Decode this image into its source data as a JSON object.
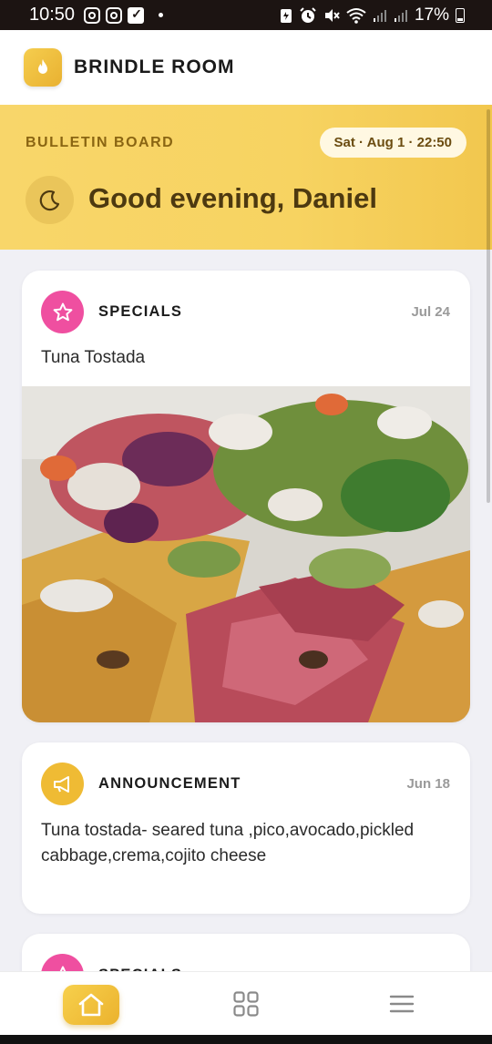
{
  "status_bar": {
    "time": "10:50",
    "battery": "17%",
    "icons": [
      "instagram-icon",
      "instagram-icon",
      "check-icon",
      "notification-dot",
      "battery-saver-icon",
      "alarm-icon",
      "mute-icon",
      "wifi-icon",
      "signal-icon",
      "signal-icon",
      "battery-icon"
    ]
  },
  "header": {
    "app_title": "BRINDLE ROOM",
    "logo_icon": "flame-icon",
    "accent": "#efbb34"
  },
  "banner": {
    "label": "BULLETIN BOARD",
    "date": "Sat · Aug 1 · 22:50",
    "greeting": "Good evening, Daniel",
    "icon": "moon-icon"
  },
  "posts": [
    {
      "category": "SPECIALS",
      "date": "Jul 24",
      "text": "Tuna Tostada",
      "icon": "star-icon",
      "color": "#ef4fa0",
      "has_image": true
    },
    {
      "category": "ANNOUNCEMENT",
      "date": "Jun 18",
      "text": "Tuna tostada- seared tuna ,pico,avocado,pickled cabbage,crema,cojito cheese",
      "icon": "megaphone-icon",
      "color": "#efbb34",
      "has_image": false
    },
    {
      "category": "SPECIALS",
      "date": "",
      "text": "",
      "icon": "star-icon",
      "color": "#ef4fa0",
      "has_image": false
    }
  ],
  "bottom_nav": {
    "items": [
      "home-icon",
      "grid-icon",
      "menu-icon"
    ],
    "active": "home-icon"
  }
}
